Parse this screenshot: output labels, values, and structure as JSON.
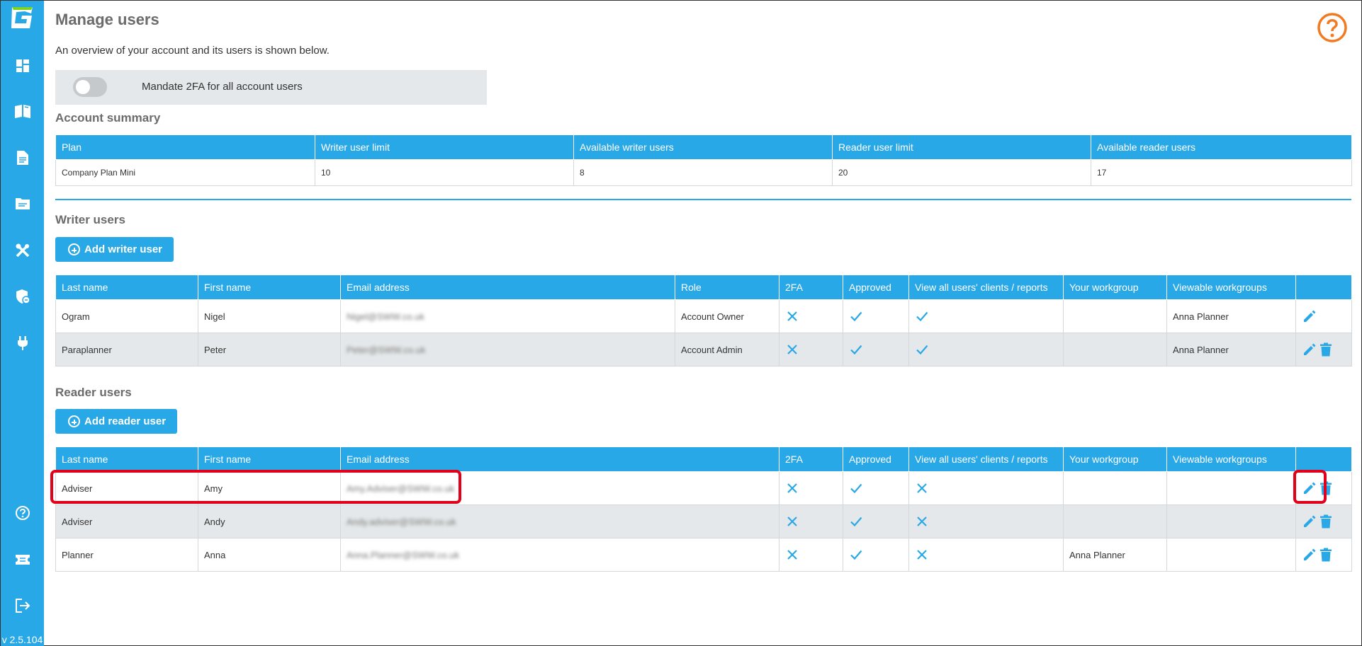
{
  "app": {
    "version": "v 2.5.104"
  },
  "sidebar": {
    "items": [
      {
        "icon": "logo-icon"
      },
      {
        "icon": "dashboard-icon"
      },
      {
        "icon": "book-icon"
      },
      {
        "icon": "document-icon"
      },
      {
        "icon": "folder-icon"
      },
      {
        "icon": "tools-icon"
      },
      {
        "icon": "shield-icon"
      },
      {
        "icon": "plug-icon"
      },
      {
        "icon": "help-icon"
      },
      {
        "icon": "ticket-icon"
      },
      {
        "icon": "logout-icon"
      }
    ]
  },
  "page": {
    "title": "Manage users",
    "subtitle": "An overview of your account and its users is shown below."
  },
  "mfa": {
    "label": "Mandate 2FA for all account users",
    "enabled": false
  },
  "account_summary": {
    "title": "Account summary",
    "headers": [
      "Plan",
      "Writer user limit",
      "Available writer users",
      "Reader user limit",
      "Available reader users"
    ],
    "row": [
      "Company Plan Mini",
      "10",
      "8",
      "20",
      "17"
    ]
  },
  "writer_users": {
    "title": "Writer users",
    "add_label": "Add writer user",
    "headers": [
      "Last name",
      "First name",
      "Email address",
      "Role",
      "2FA",
      "Approved",
      "View all users' clients / reports",
      "Your workgroup",
      "Viewable workgroups",
      ""
    ],
    "rows": [
      {
        "last": "Ogram",
        "first": "Nigel",
        "email": "Nigel@SWW.co.uk",
        "role": "Account Owner",
        "tfa": "cross",
        "approved": "check",
        "view_all": "check",
        "workgroup": "",
        "viewable": "Anna Planner",
        "delete": false
      },
      {
        "last": "Paraplanner",
        "first": "Peter",
        "email": "Peter@SWW.co.uk",
        "role": "Account Admin",
        "tfa": "cross",
        "approved": "check",
        "view_all": "check",
        "workgroup": "",
        "viewable": "Anna Planner",
        "delete": true
      }
    ]
  },
  "reader_users": {
    "title": "Reader users",
    "add_label": "Add reader user",
    "headers": [
      "Last name",
      "First name",
      "Email address",
      "2FA",
      "Approved",
      "View all users' clients / reports",
      "Your workgroup",
      "Viewable workgroups",
      ""
    ],
    "rows": [
      {
        "last": "Adviser",
        "first": "Amy",
        "email": "Amy.Adviser@SWW.co.uk",
        "tfa": "cross",
        "approved": "check",
        "view_all": "cross",
        "workgroup": "",
        "viewable": "",
        "delete": true
      },
      {
        "last": "Adviser",
        "first": "Andy",
        "email": "Andy.adviser@SWW.co.uk",
        "tfa": "cross",
        "approved": "check",
        "view_all": "cross",
        "workgroup": "",
        "viewable": "",
        "delete": true
      },
      {
        "last": "Planner",
        "first": "Anna",
        "email": "Anna.Planner@SWW.co.uk",
        "tfa": "cross",
        "approved": "check",
        "view_all": "cross",
        "workgroup": "Anna Planner",
        "viewable": "",
        "delete": true
      }
    ]
  },
  "colors": {
    "primary": "#29a8e8",
    "help": "#f07b22",
    "highlight": "#e2001a",
    "row_alt": "#e5e8ea"
  }
}
